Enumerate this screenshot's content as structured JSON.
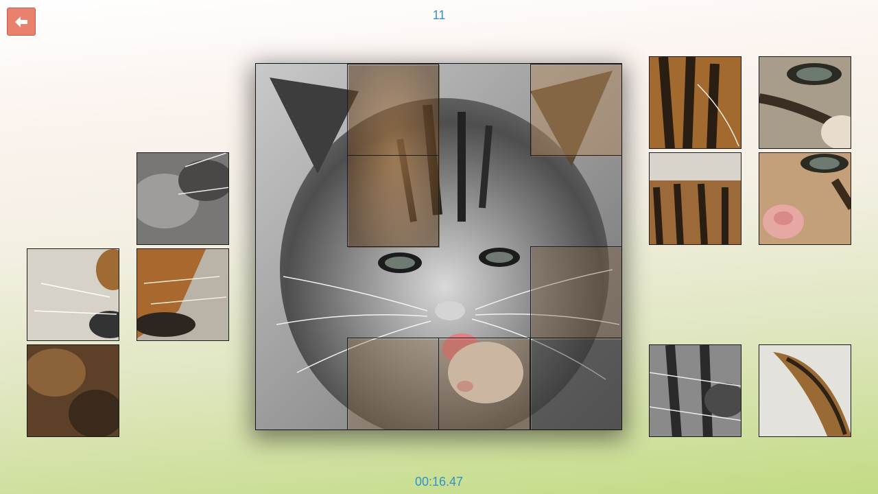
{
  "header": {
    "move_count": "11"
  },
  "footer": {
    "timer": "00:16.47"
  },
  "controls": {
    "back_icon": "arrow-left-icon",
    "accent_color": "#e8826f",
    "text_color": "#2f93c7"
  },
  "puzzle": {
    "subject": "kitten",
    "grid": "4x4",
    "placed_tiles": 16,
    "loose_tiles": 10
  }
}
